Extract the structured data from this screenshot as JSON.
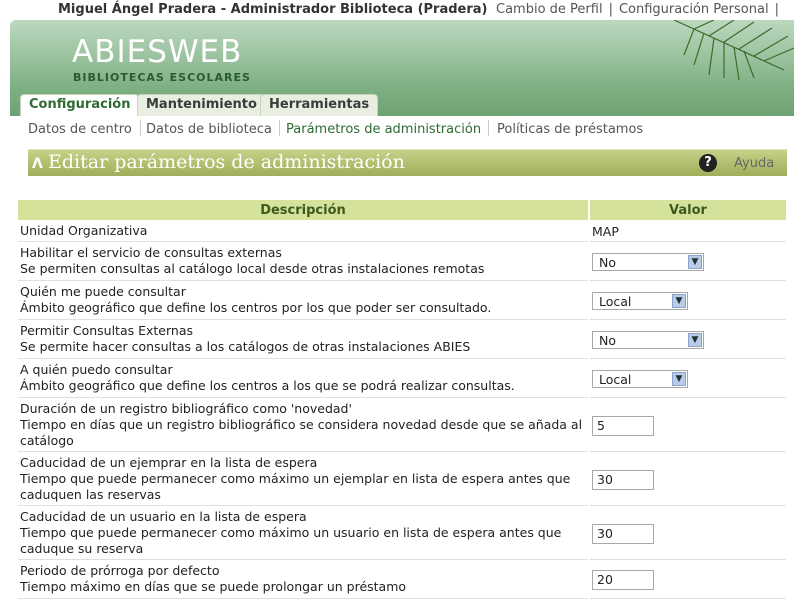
{
  "user": "Miguel Ángel Pradera - Administrador Biblioteca (Pradera)",
  "top_links": [
    "Cambio de Perfil",
    "Configuración Personal"
  ],
  "logo": {
    "name": "ABIESWEB",
    "subtitle": "BIBLIOTECAS ESCOLARES"
  },
  "tabs": [
    {
      "label": "Configuración",
      "active": true
    },
    {
      "label": "Mantenimiento",
      "active": false
    },
    {
      "label": "Herramientas",
      "active": false
    }
  ],
  "subnav": [
    {
      "label": "Datos de centro",
      "active": false
    },
    {
      "label": "Datos de biblioteca",
      "active": false
    },
    {
      "label": "Parámetros de administración",
      "active": true
    },
    {
      "label": "Políticas de préstamos",
      "active": false
    }
  ],
  "page": {
    "title": "Editar parámetros de administración",
    "help": "Ayuda"
  },
  "table": {
    "headers": [
      "Descripción",
      "Valor"
    ],
    "rows": [
      {
        "title": "Unidad Organizativa",
        "desc": "",
        "type": "text",
        "value": "MAP"
      },
      {
        "title": "Habilitar el servicio de consultas externas",
        "desc": "Se permiten consultas al catálogo local desde otras instalaciones remotas",
        "type": "select",
        "value": "No"
      },
      {
        "title": "Quién me puede consultar",
        "desc": "Ámbito geográfico que define los centros por los que poder ser consultado.",
        "type": "select",
        "value": "Local"
      },
      {
        "title": "Permitir Consultas Externas",
        "desc": "Se permite hacer consultas a los catálogos de otras instalaciones ABIES",
        "type": "select",
        "value": "No"
      },
      {
        "title": "A quién puedo consultar",
        "desc": "Ámbito geográfico que define los centros a los que se podrá realizar consultas.",
        "type": "select",
        "value": "Local"
      },
      {
        "title": "Duración de un registro bibliográfico como 'novedad'",
        "desc": "Tiempo en días que un registro bibliográfico se considera novedad desde que se añada al catálogo",
        "type": "input",
        "value": "5"
      },
      {
        "title": "Caducidad de un ejemprar en la lista de espera",
        "desc": "Tiempo que puede permanecer como máximo un ejemplar en lista de espera antes que caduquen las reservas",
        "type": "input",
        "value": "30"
      },
      {
        "title": "Caducidad de un usuario en la lista de espera",
        "desc": "Tiempo que puede permanecer como máximo un usuario en lista de espera antes que caduque su reserva",
        "type": "input",
        "value": "30"
      },
      {
        "title": "Periodo de prórroga por defecto",
        "desc": "Tiempo máximo en días que se puede prolongar un préstamo",
        "type": "input",
        "value": "20"
      }
    ]
  }
}
